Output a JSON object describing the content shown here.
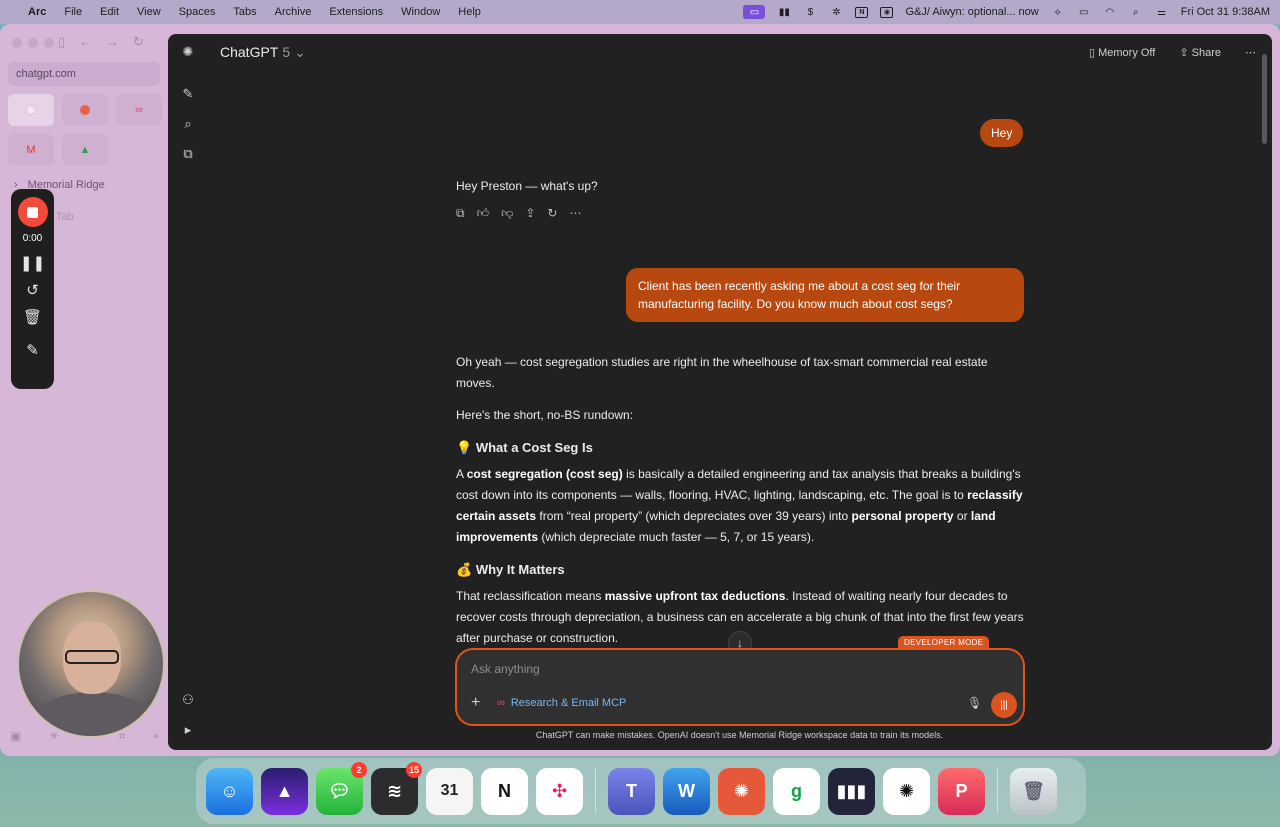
{
  "menubar": {
    "app_name": "Arc",
    "menus": [
      "File",
      "Edit",
      "View",
      "Spaces",
      "Tabs",
      "Archive",
      "Extensions",
      "Window",
      "Help"
    ],
    "notification": "G&J/ Aiwyn: optional... now",
    "datetime": "Fri Oct 31  9:38AM"
  },
  "sidebar": {
    "url": "chatgpt.com",
    "folder": "Memorial Ridge",
    "new_tab": "Tab"
  },
  "recorder": {
    "time": "0:00"
  },
  "header": {
    "title": "ChatGPT",
    "version": "5",
    "memory": "Memory Off",
    "share": "Share"
  },
  "messages": {
    "user_1": "Hey",
    "assistant_1": "Hey Preston — what's up?",
    "user_2": "Client has been recently asking me about a cost seg for their manufacturing facility. Do you know much about cost segs?",
    "assistant_2": {
      "intro": "Oh yeah — cost segregation studies are right in the wheelhouse of tax-smart commercial real estate moves.",
      "rundown": "Here's the short, no-BS rundown:",
      "h1_emoji": "💡",
      "h1": "What a Cost Seg Is",
      "p1": {
        "a": "A ",
        "b": "cost segregation (cost seg)",
        "c": " is basically a detailed engineering and tax analysis that breaks a building's cost down into its components — walls, flooring, HVAC, lighting, landscaping, etc. The goal is to ",
        "d": "reclassify certain assets",
        "e": " from “real property” (which depreciates over 39 years) into ",
        "f": "personal property",
        "g": " or ",
        "h": "land improvements",
        "i": " (which depreciate much faster — 5, 7, or 15 years)."
      },
      "h2_emoji": "💰",
      "h2": "Why It Matters",
      "p2": {
        "a": "That reclassification means ",
        "b": "massive upfront tax deductions",
        "c": ". Instead of waiting nearly four decades to recover costs through depreciation, a business can ",
        "d": "en accelerate a big chunk of that into the first few years after purchase or construction."
      }
    }
  },
  "composer": {
    "badge": "DEVELOPER MODE",
    "placeholder": "Ask anything",
    "tool": "Research & Email MCP"
  },
  "disclaimer": "ChatGPT can make mistakes. OpenAI doesn't use Memorial Ridge workspace data to train its models.",
  "dock": {
    "messages_badge": "2",
    "app_badge": "15",
    "calendar_day": "31"
  },
  "colors": {
    "accent": "#b7480f",
    "composer_border": "#e0531a",
    "panel_bg": "#212121"
  }
}
